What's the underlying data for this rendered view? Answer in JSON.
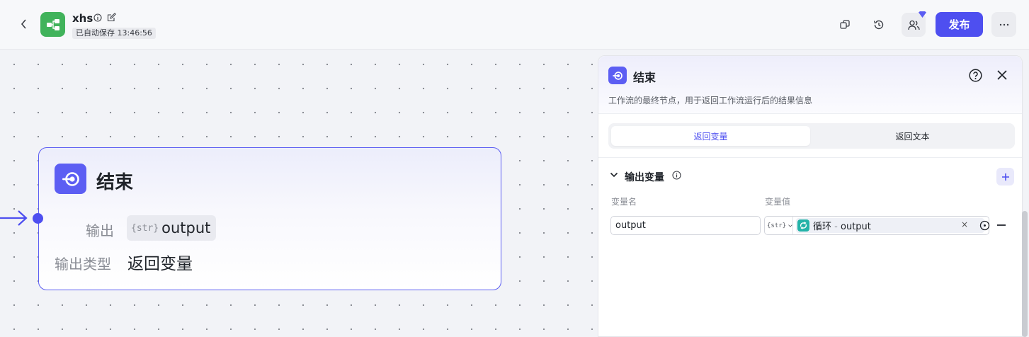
{
  "header": {
    "app_name": "xhs",
    "autosave_status": "已自动保存 13:46:56",
    "publish_label": "发布"
  },
  "node": {
    "title": "结束",
    "output_label": "输出",
    "output_type_tag": "{str}",
    "output_value": "output",
    "output_type_label": "输出类型",
    "output_type_value": "返回变量"
  },
  "panel": {
    "title": "结束",
    "description": "工作流的最终节点，用于返回工作流运行后的结果信息",
    "tabs": [
      {
        "label": "返回变量",
        "active": true
      },
      {
        "label": "返回文本",
        "active": false
      }
    ],
    "section_title": "输出变量",
    "col_name_header": "变量名",
    "col_value_header": "变量值",
    "rows": [
      {
        "name": "output",
        "type_tag": "{str}",
        "ref_source": "循环",
        "ref_separator": "-",
        "ref_variable": "output"
      }
    ]
  },
  "colors": {
    "accent": "#4e4ff0",
    "node_icon": "#5c5ef3",
    "app_logo": "#41b35b",
    "loop_icon": "#23b3a8"
  }
}
